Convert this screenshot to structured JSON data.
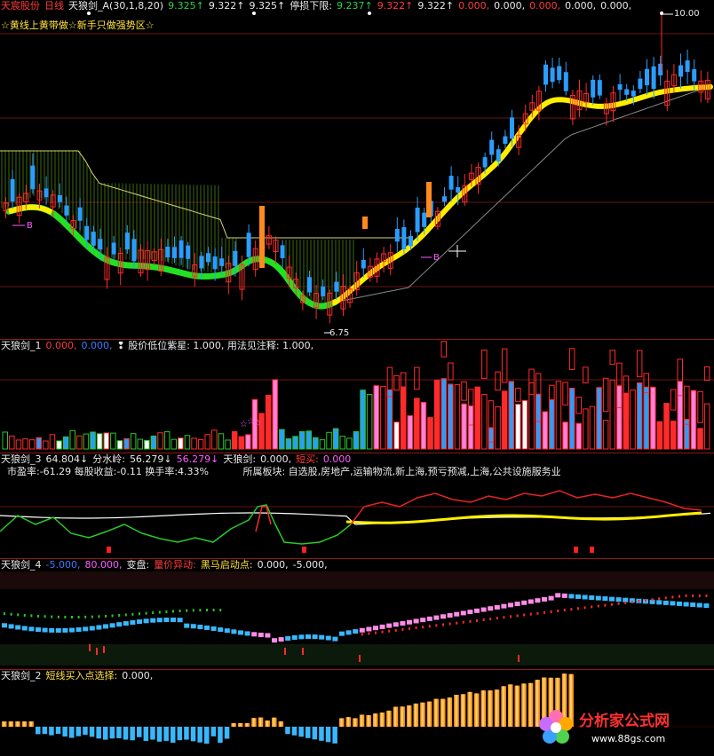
{
  "pane1": {
    "stock_name": "天宸股份",
    "period": "日线",
    "indicator": "天狼剑_A(30,1,8,20)",
    "vals": [
      "9.325↑",
      "9.322↑",
      "9.325↑"
    ],
    "stop_label": "停损下限:",
    "vals2": [
      "9.237↑",
      "9.322↑",
      "9.322↑",
      "0.000,",
      "0.000,",
      "0.000,",
      "0.000,",
      "0.000,"
    ],
    "subtitle": "☆黄线上黄带做☆新手只做强势区☆",
    "high_label": "10.00",
    "low_label": "6.75",
    "buy_marker": "B",
    "buy_marker2": "B"
  },
  "pane2": {
    "title": "天狼剑_1",
    "v1": "0.000,",
    "v2": "0.000,",
    "note": "❢ 股价低位紫星: 1.000, 用法见注释: 1.000,"
  },
  "pane3": {
    "title": "天狼剑_3",
    "v1": "64.804↓",
    "fsl_label": "分水岭:",
    "fsl": "56.279↓",
    "v3": "56.279↓",
    "tlj_label": "天狼剑:",
    "tlj": "0.000,",
    "dx_label": "短买:",
    "dx": "0.000",
    "info": "市盈率:-61.29 每股收益:-0.11 换手率:4.33%",
    "sector": "所属板块: 自选股,房地产,运输物流,新上海,预亏预减,上海,公共设施服务业"
  },
  "pane4": {
    "title": "天狼剑_4",
    "v1": "-5.000,",
    "v2": "80.000,",
    "bp_label": "变盘:",
    "ljyd": "量价异动:",
    "hm_label": "黑马启动点:",
    "hm": "0.000,",
    "v5": "-5.000,"
  },
  "pane5": {
    "title": "天狼剑_2",
    "label": "短线买入点选择:",
    "value": "0.000,"
  },
  "logo": {
    "name": "分析家公式网",
    "url": "www.88gs.com"
  },
  "colors": {
    "up": "#ff2a2a",
    "down": "#2a9dff",
    "yellow": "#ffe600",
    "green": "#2fe02f",
    "grid": "#8b1a1a"
  },
  "chart_data": {
    "type": "candlestick",
    "price_high_marker": 10.0,
    "price_low_marker": 6.75
  }
}
